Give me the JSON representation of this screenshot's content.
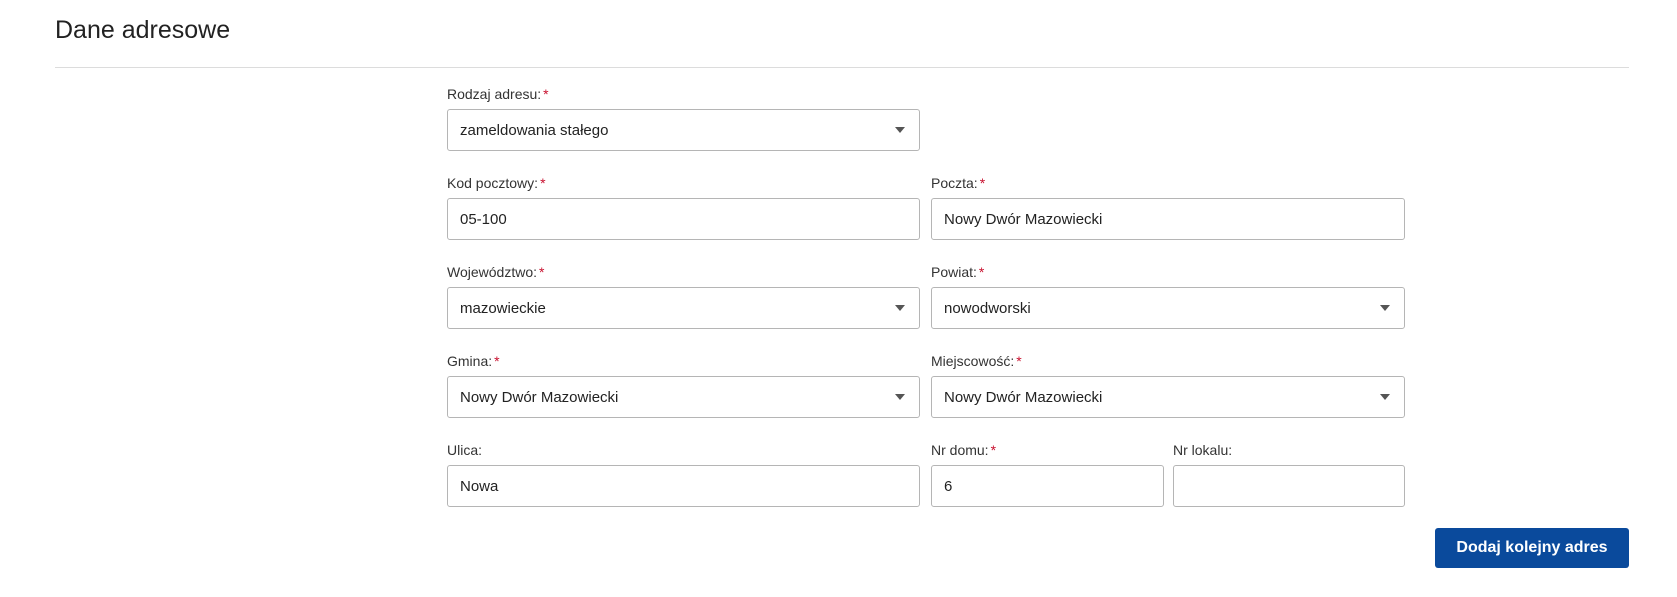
{
  "section": {
    "title": "Dane adresowe"
  },
  "required_mark": "*",
  "fields": {
    "rodzaj_adresu": {
      "label": "Rodzaj adresu:",
      "value": "zameldowania stałego"
    },
    "kod_pocztowy": {
      "label": "Kod pocztowy:",
      "value": "05-100"
    },
    "poczta": {
      "label": "Poczta:",
      "value": "Nowy Dwór Mazowiecki"
    },
    "wojewodztwo": {
      "label": "Województwo:",
      "value": "mazowieckie"
    },
    "powiat": {
      "label": "Powiat:",
      "value": "nowodworski"
    },
    "gmina": {
      "label": "Gmina:",
      "value": "Nowy Dwór Mazowiecki"
    },
    "miejscowosc": {
      "label": "Miejscowość:",
      "value": "Nowy Dwór Mazowiecki"
    },
    "ulica": {
      "label": "Ulica:",
      "value": "Nowa"
    },
    "nr_domu": {
      "label": "Nr domu:",
      "value": "6"
    },
    "nr_lokalu": {
      "label": "Nr lokalu:",
      "value": ""
    }
  },
  "actions": {
    "add_address_label": "Dodaj kolejny adres"
  },
  "colors": {
    "primary_button": "#0a4a9c",
    "required": "#c8102e"
  }
}
